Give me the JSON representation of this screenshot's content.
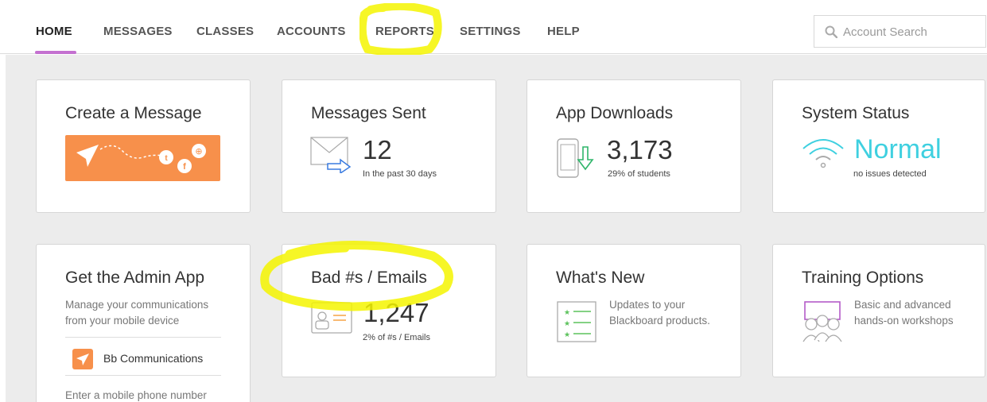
{
  "nav": {
    "items": [
      {
        "label": "HOME",
        "active": true
      },
      {
        "label": "MESSAGES"
      },
      {
        "label": "CLASSES"
      },
      {
        "label": "ACCOUNTS"
      },
      {
        "label": "REPORTS"
      },
      {
        "label": "SETTINGS"
      },
      {
        "label": "HELP"
      }
    ],
    "search_placeholder": "Account Search"
  },
  "cards": {
    "create_message": {
      "title": "Create a Message"
    },
    "messages_sent": {
      "title": "Messages Sent",
      "value": "12",
      "sub": "In the past 30 days"
    },
    "app_downloads": {
      "title": "App Downloads",
      "value": "3,173",
      "sub": "29% of students"
    },
    "system_status": {
      "title": "System Status",
      "value": "Normal",
      "sub": "no issues detected"
    },
    "admin_app": {
      "title": "Get the Admin App",
      "desc": "Manage your communications from your mobile device",
      "app_name": "Bb Communications",
      "footer": "Enter a mobile phone number"
    },
    "bad_numbers": {
      "title": "Bad #s / Emails",
      "value": "1,247",
      "sub": "2% of #s / Emails"
    },
    "whats_new": {
      "title": "What's New",
      "desc": "Updates to your Blackboard products."
    },
    "training": {
      "title": "Training Options",
      "desc": "Basic and advanced hands-on workshops"
    }
  },
  "colors": {
    "accent_purple": "#c470d0",
    "orange": "#f7904b",
    "teal": "#3fd0e0",
    "highlight": "#f5f500"
  }
}
